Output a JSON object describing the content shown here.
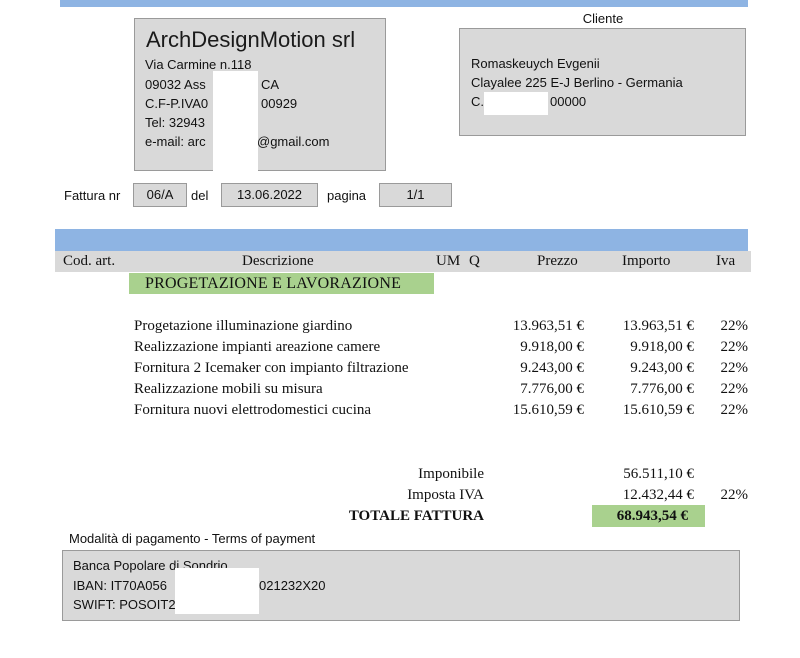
{
  "sender": {
    "company": "ArchDesignMotion srl",
    "address": "Via Carmine n.118",
    "city_prefix": "09032  Ass",
    "city_suffix": "CA",
    "vat_prefix": "C.F-P.IVA0",
    "vat_suffix": "00929",
    "tel": "Tel: 32943",
    "email_prefix": "e-mail: arc",
    "email_suffix": "@gmail.com"
  },
  "client": {
    "label": "Cliente",
    "name": "Romaskeuych Evgenii",
    "address": "Clayalee 225 E-J Berlino - Germania",
    "code_prefix": "C.",
    "code_suffix": "00000"
  },
  "invoice": {
    "number_label": "Fattura nr",
    "number": "06/A",
    "date_label": "del",
    "date": "13.06.2022",
    "page_label": "pagina",
    "page": "1/1"
  },
  "table": {
    "headers": {
      "code": "Cod. art.",
      "description": "Descrizione",
      "um": "UM",
      "q": "Q",
      "price": "Prezzo",
      "amount": "Importo",
      "vat": "Iva"
    },
    "section_title": "PROGETAZIONE E LAVORAZIONE",
    "rows": [
      {
        "description": "Progetazione illuminazione giardino",
        "price": "13.963,51 €",
        "amount": "13.963,51 €",
        "vat": "22%"
      },
      {
        "description": "Realizzazione impianti areazione camere",
        "price": "9.918,00 €",
        "amount": "9.918,00 €",
        "vat": "22%"
      },
      {
        "description": "Fornitura 2 Icemaker con impianto filtrazione",
        "price": "9.243,00 €",
        "amount": "9.243,00 €",
        "vat": "22%"
      },
      {
        "description": "Realizzazione mobili su misura",
        "price": "7.776,00 €",
        "amount": "7.776,00 €",
        "vat": "22%"
      },
      {
        "description": "Fornitura nuovi elettrodomestici cucina",
        "price": "15.610,59 €",
        "amount": "15.610,59 €",
        "vat": "22%"
      }
    ]
  },
  "totals": {
    "taxable_label": "Imponibile",
    "taxable": "56.511,10 €",
    "tax_label": "Imposta IVA",
    "tax": "12.432,44 €",
    "tax_rate": "22%",
    "total_label": "TOTALE FATTURA",
    "total": "68.943,54 €"
  },
  "payment": {
    "label": "Modalità di pagamento - Terms of payment",
    "bank": "Banca Popolare di Sondrio",
    "iban_prefix": "IBAN: IT70A056",
    "iban_suffix": "021232X20",
    "swift_prefix": "SWIFT: POSOIT2"
  },
  "colors": {
    "header_blue": "#8eb4e3",
    "box_gray": "#d9d9d9",
    "highlight_green": "#a9d18e"
  }
}
